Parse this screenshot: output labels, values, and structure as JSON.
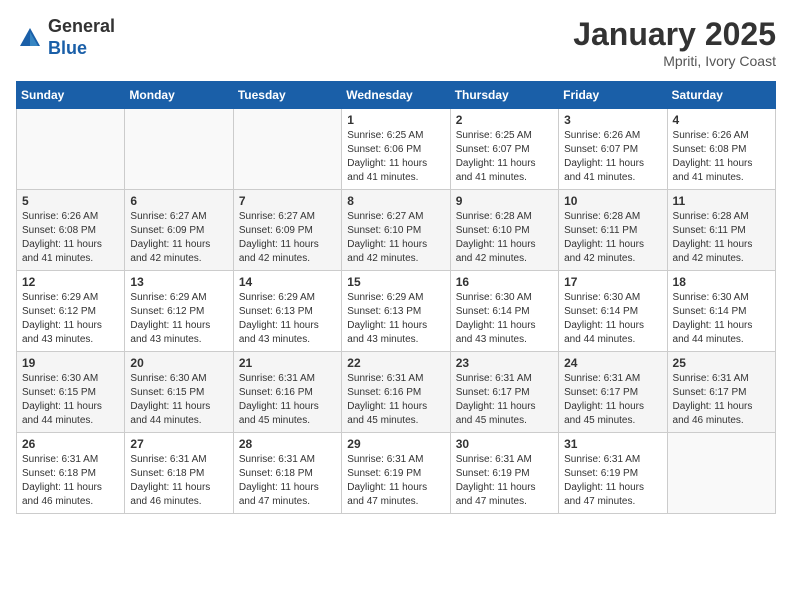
{
  "header": {
    "logo_line1": "General",
    "logo_line2": "Blue",
    "month_title": "January 2025",
    "location": "Mpriti, Ivory Coast"
  },
  "weekdays": [
    "Sunday",
    "Monday",
    "Tuesday",
    "Wednesday",
    "Thursday",
    "Friday",
    "Saturday"
  ],
  "weeks": [
    [
      {
        "day": "",
        "sunrise": "",
        "sunset": "",
        "daylight": ""
      },
      {
        "day": "",
        "sunrise": "",
        "sunset": "",
        "daylight": ""
      },
      {
        "day": "",
        "sunrise": "",
        "sunset": "",
        "daylight": ""
      },
      {
        "day": "1",
        "sunrise": "Sunrise: 6:25 AM",
        "sunset": "Sunset: 6:06 PM",
        "daylight": "Daylight: 11 hours and 41 minutes."
      },
      {
        "day": "2",
        "sunrise": "Sunrise: 6:25 AM",
        "sunset": "Sunset: 6:07 PM",
        "daylight": "Daylight: 11 hours and 41 minutes."
      },
      {
        "day": "3",
        "sunrise": "Sunrise: 6:26 AM",
        "sunset": "Sunset: 6:07 PM",
        "daylight": "Daylight: 11 hours and 41 minutes."
      },
      {
        "day": "4",
        "sunrise": "Sunrise: 6:26 AM",
        "sunset": "Sunset: 6:08 PM",
        "daylight": "Daylight: 11 hours and 41 minutes."
      }
    ],
    [
      {
        "day": "5",
        "sunrise": "Sunrise: 6:26 AM",
        "sunset": "Sunset: 6:08 PM",
        "daylight": "Daylight: 11 hours and 41 minutes."
      },
      {
        "day": "6",
        "sunrise": "Sunrise: 6:27 AM",
        "sunset": "Sunset: 6:09 PM",
        "daylight": "Daylight: 11 hours and 42 minutes."
      },
      {
        "day": "7",
        "sunrise": "Sunrise: 6:27 AM",
        "sunset": "Sunset: 6:09 PM",
        "daylight": "Daylight: 11 hours and 42 minutes."
      },
      {
        "day": "8",
        "sunrise": "Sunrise: 6:27 AM",
        "sunset": "Sunset: 6:10 PM",
        "daylight": "Daylight: 11 hours and 42 minutes."
      },
      {
        "day": "9",
        "sunrise": "Sunrise: 6:28 AM",
        "sunset": "Sunset: 6:10 PM",
        "daylight": "Daylight: 11 hours and 42 minutes."
      },
      {
        "day": "10",
        "sunrise": "Sunrise: 6:28 AM",
        "sunset": "Sunset: 6:11 PM",
        "daylight": "Daylight: 11 hours and 42 minutes."
      },
      {
        "day": "11",
        "sunrise": "Sunrise: 6:28 AM",
        "sunset": "Sunset: 6:11 PM",
        "daylight": "Daylight: 11 hours and 42 minutes."
      }
    ],
    [
      {
        "day": "12",
        "sunrise": "Sunrise: 6:29 AM",
        "sunset": "Sunset: 6:12 PM",
        "daylight": "Daylight: 11 hours and 43 minutes."
      },
      {
        "day": "13",
        "sunrise": "Sunrise: 6:29 AM",
        "sunset": "Sunset: 6:12 PM",
        "daylight": "Daylight: 11 hours and 43 minutes."
      },
      {
        "day": "14",
        "sunrise": "Sunrise: 6:29 AM",
        "sunset": "Sunset: 6:13 PM",
        "daylight": "Daylight: 11 hours and 43 minutes."
      },
      {
        "day": "15",
        "sunrise": "Sunrise: 6:29 AM",
        "sunset": "Sunset: 6:13 PM",
        "daylight": "Daylight: 11 hours and 43 minutes."
      },
      {
        "day": "16",
        "sunrise": "Sunrise: 6:30 AM",
        "sunset": "Sunset: 6:14 PM",
        "daylight": "Daylight: 11 hours and 43 minutes."
      },
      {
        "day": "17",
        "sunrise": "Sunrise: 6:30 AM",
        "sunset": "Sunset: 6:14 PM",
        "daylight": "Daylight: 11 hours and 44 minutes."
      },
      {
        "day": "18",
        "sunrise": "Sunrise: 6:30 AM",
        "sunset": "Sunset: 6:14 PM",
        "daylight": "Daylight: 11 hours and 44 minutes."
      }
    ],
    [
      {
        "day": "19",
        "sunrise": "Sunrise: 6:30 AM",
        "sunset": "Sunset: 6:15 PM",
        "daylight": "Daylight: 11 hours and 44 minutes."
      },
      {
        "day": "20",
        "sunrise": "Sunrise: 6:30 AM",
        "sunset": "Sunset: 6:15 PM",
        "daylight": "Daylight: 11 hours and 44 minutes."
      },
      {
        "day": "21",
        "sunrise": "Sunrise: 6:31 AM",
        "sunset": "Sunset: 6:16 PM",
        "daylight": "Daylight: 11 hours and 45 minutes."
      },
      {
        "day": "22",
        "sunrise": "Sunrise: 6:31 AM",
        "sunset": "Sunset: 6:16 PM",
        "daylight": "Daylight: 11 hours and 45 minutes."
      },
      {
        "day": "23",
        "sunrise": "Sunrise: 6:31 AM",
        "sunset": "Sunset: 6:17 PM",
        "daylight": "Daylight: 11 hours and 45 minutes."
      },
      {
        "day": "24",
        "sunrise": "Sunrise: 6:31 AM",
        "sunset": "Sunset: 6:17 PM",
        "daylight": "Daylight: 11 hours and 45 minutes."
      },
      {
        "day": "25",
        "sunrise": "Sunrise: 6:31 AM",
        "sunset": "Sunset: 6:17 PM",
        "daylight": "Daylight: 11 hours and 46 minutes."
      }
    ],
    [
      {
        "day": "26",
        "sunrise": "Sunrise: 6:31 AM",
        "sunset": "Sunset: 6:18 PM",
        "daylight": "Daylight: 11 hours and 46 minutes."
      },
      {
        "day": "27",
        "sunrise": "Sunrise: 6:31 AM",
        "sunset": "Sunset: 6:18 PM",
        "daylight": "Daylight: 11 hours and 46 minutes."
      },
      {
        "day": "28",
        "sunrise": "Sunrise: 6:31 AM",
        "sunset": "Sunset: 6:18 PM",
        "daylight": "Daylight: 11 hours and 47 minutes."
      },
      {
        "day": "29",
        "sunrise": "Sunrise: 6:31 AM",
        "sunset": "Sunset: 6:19 PM",
        "daylight": "Daylight: 11 hours and 47 minutes."
      },
      {
        "day": "30",
        "sunrise": "Sunrise: 6:31 AM",
        "sunset": "Sunset: 6:19 PM",
        "daylight": "Daylight: 11 hours and 47 minutes."
      },
      {
        "day": "31",
        "sunrise": "Sunrise: 6:31 AM",
        "sunset": "Sunset: 6:19 PM",
        "daylight": "Daylight: 11 hours and 47 minutes."
      },
      {
        "day": "",
        "sunrise": "",
        "sunset": "",
        "daylight": ""
      }
    ]
  ]
}
